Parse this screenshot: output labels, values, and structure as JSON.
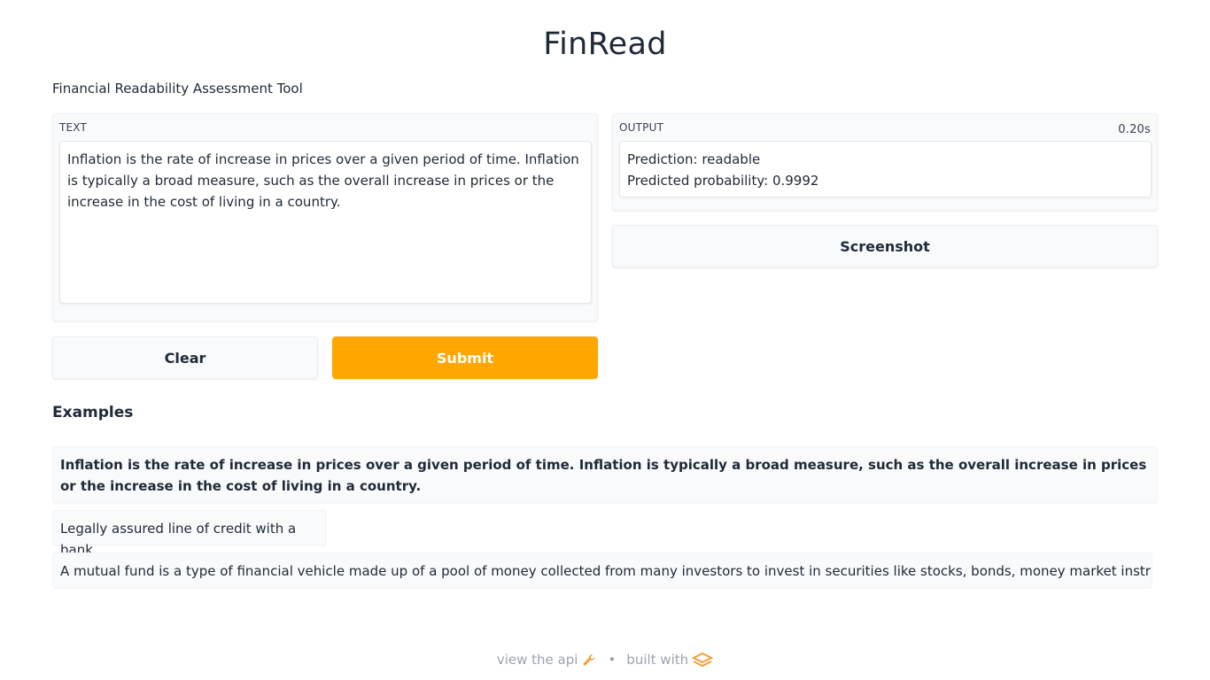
{
  "app": {
    "title": "FinRead",
    "description": "Financial Readability Assessment Tool"
  },
  "input": {
    "label": "TEXT",
    "value": "Inflation is the rate of increase in prices over a given period of time. Inflation is typically a broad measure, such as the overall increase in prices or the increase in the cost of living in a country."
  },
  "output": {
    "label": "OUTPUT",
    "timing": "0.20s",
    "prediction_line": "Prediction: readable",
    "probability_line": "Predicted probability: 0.9992"
  },
  "buttons": {
    "clear": "Clear",
    "submit": "Submit",
    "screenshot": "Screenshot"
  },
  "examples": {
    "heading": "Examples",
    "items": [
      "Inflation is the rate of increase in prices over a given period of time. Inflation is typically a broad measure, such as the overall increase in prices or the increase in the cost of living in a country.",
      "Legally assured line of credit with a bank",
      "A mutual fund is a type of financial vehicle made up of a pool of money collected from many investors to invest in securities like stocks, bonds, money market instruments"
    ]
  },
  "footer": {
    "api_link": "view the api",
    "separator": "•",
    "built_with": "built with",
    "api_icon": "wrench-icon",
    "logo_icon": "gradio-logo-icon"
  },
  "colors": {
    "primary": "#ffa600",
    "panel_bg": "#f9fafb",
    "text": "#1f2937",
    "muted": "#9ca3af"
  }
}
